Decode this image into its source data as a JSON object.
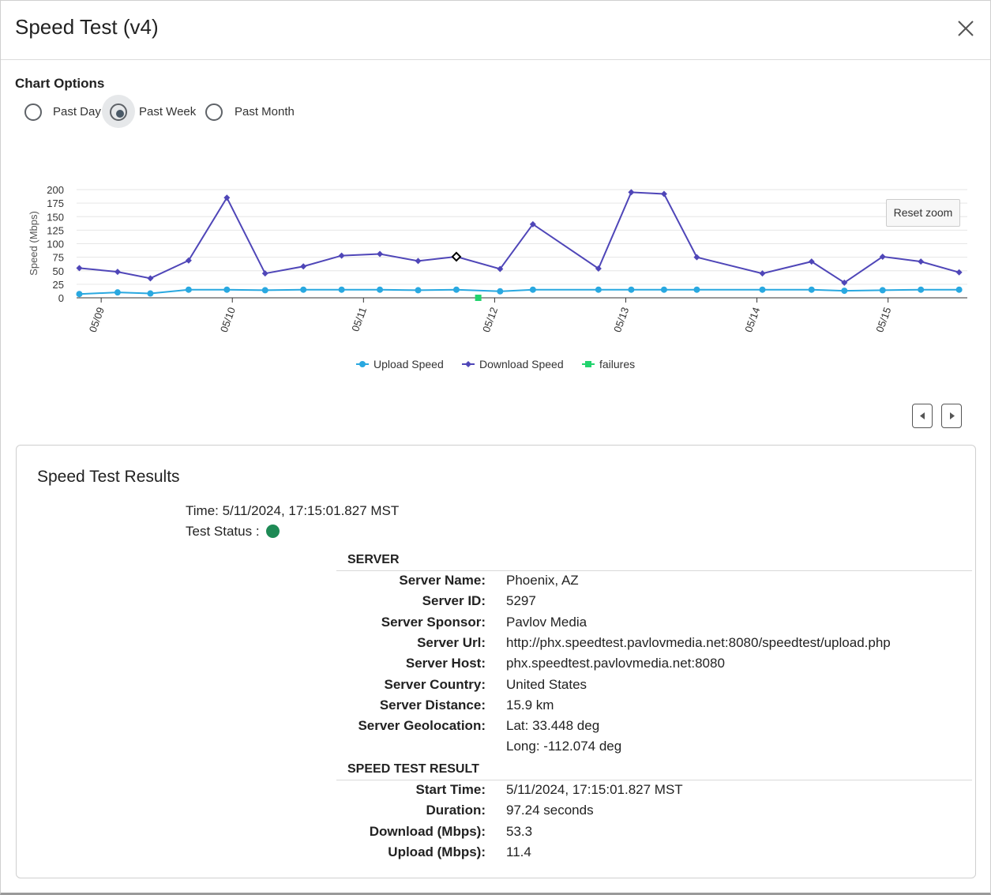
{
  "dialog": {
    "title": "Speed Test (v4)"
  },
  "chart_options": {
    "label": "Chart Options",
    "options": [
      {
        "label": "Past Day",
        "selected": false
      },
      {
        "label": "Past Week",
        "selected": true
      },
      {
        "label": "Past Month",
        "selected": false
      }
    ]
  },
  "chart_controls": {
    "reset_zoom_label": "Reset zoom"
  },
  "chart_data": {
    "type": "line",
    "ylabel": "Speed (Mbps)",
    "ylim": [
      0,
      200
    ],
    "yticks": [
      0,
      25,
      50,
      75,
      100,
      125,
      150,
      175,
      200
    ],
    "x_axis": "time",
    "xticks": [
      "05/09",
      "05/10",
      "05/11",
      "05/12",
      "05/13",
      "05/14",
      "05/15"
    ],
    "grid": true,
    "legend_position": "bottom",
    "colors": {
      "upload": "#29a8e0",
      "download": "#4f46b8",
      "failures": "#22d36e"
    },
    "series": [
      {
        "name": "Upload Speed",
        "x": [
          "2024-05-08 20:00",
          "2024-05-09 03:00",
          "2024-05-09 09:00",
          "2024-05-09 16:00",
          "2024-05-09 23:00",
          "2024-05-10 06:00",
          "2024-05-10 13:00",
          "2024-05-10 20:00",
          "2024-05-11 03:00",
          "2024-05-11 10:00",
          "2024-05-11 17:00",
          "2024-05-12 01:00",
          "2024-05-12 07:00",
          "2024-05-12 19:00",
          "2024-05-13 01:00",
          "2024-05-13 07:00",
          "2024-05-13 13:00",
          "2024-05-14 01:00",
          "2024-05-14 10:00",
          "2024-05-14 16:00",
          "2024-05-14 23:00",
          "2024-05-15 06:00",
          "2024-05-15 13:00"
        ],
        "values": [
          7,
          10,
          8,
          15,
          15,
          14,
          15,
          15,
          15,
          14,
          15,
          12,
          15,
          15,
          15,
          15,
          15,
          15,
          15,
          13,
          14,
          15,
          15
        ]
      },
      {
        "name": "Download Speed",
        "x": [
          "2024-05-08 20:00",
          "2024-05-09 03:00",
          "2024-05-09 09:00",
          "2024-05-09 16:00",
          "2024-05-09 23:00",
          "2024-05-10 06:00",
          "2024-05-10 13:00",
          "2024-05-10 20:00",
          "2024-05-11 03:00",
          "2024-05-11 10:00",
          "2024-05-11 17:00",
          "2024-05-12 01:00",
          "2024-05-12 07:00",
          "2024-05-12 19:00",
          "2024-05-13 01:00",
          "2024-05-13 07:00",
          "2024-05-13 13:00",
          "2024-05-14 01:00",
          "2024-05-14 10:00",
          "2024-05-14 16:00",
          "2024-05-14 23:00",
          "2024-05-15 06:00",
          "2024-05-15 13:00"
        ],
        "values": [
          55,
          48,
          36,
          69,
          185,
          45,
          58,
          78,
          81,
          68,
          76,
          53.3,
          136,
          54,
          195,
          192,
          75,
          45,
          67,
          28,
          76,
          67,
          47
        ]
      },
      {
        "name": "failures",
        "x": [
          "2024-05-11 21:00"
        ],
        "values": [
          0
        ]
      }
    ],
    "highlighted_point": {
      "series": "Download Speed",
      "x": "2024-05-11 17:00",
      "value": 53.3
    }
  },
  "results": {
    "title": "Speed Test Results",
    "time_line": "Time: 5/11/2024, 17:15:01.827 MST",
    "status_label": "Test Status :",
    "status_color": "#1e8a55",
    "server_header": "SERVER",
    "server_rows": [
      {
        "key": "Server Name:",
        "value": "Phoenix, AZ"
      },
      {
        "key": "Server ID:",
        "value": "5297"
      },
      {
        "key": "Server Sponsor:",
        "value": "Pavlov Media"
      },
      {
        "key": "Server Url:",
        "value": "http://phx.speedtest.pavlovmedia.net:8080/speedtest/upload.php"
      },
      {
        "key": "Server Host:",
        "value": "phx.speedtest.pavlovmedia.net:8080"
      },
      {
        "key": "Server Country:",
        "value": "United States"
      },
      {
        "key": "Server Distance:",
        "value": "15.9 km"
      },
      {
        "key": "Server Geolocation:",
        "value": "Lat: 33.448 deg"
      },
      {
        "key": "",
        "value": "Long: -112.074 deg"
      }
    ],
    "result_header": "SPEED TEST RESULT",
    "result_rows": [
      {
        "key": "Start Time:",
        "value": "5/11/2024, 17:15:01.827 MST"
      },
      {
        "key": "Duration:",
        "value": "97.24 seconds"
      },
      {
        "key": "Download (Mbps):",
        "value": "53.3"
      },
      {
        "key": "Upload (Mbps):",
        "value": "11.4"
      }
    ]
  }
}
